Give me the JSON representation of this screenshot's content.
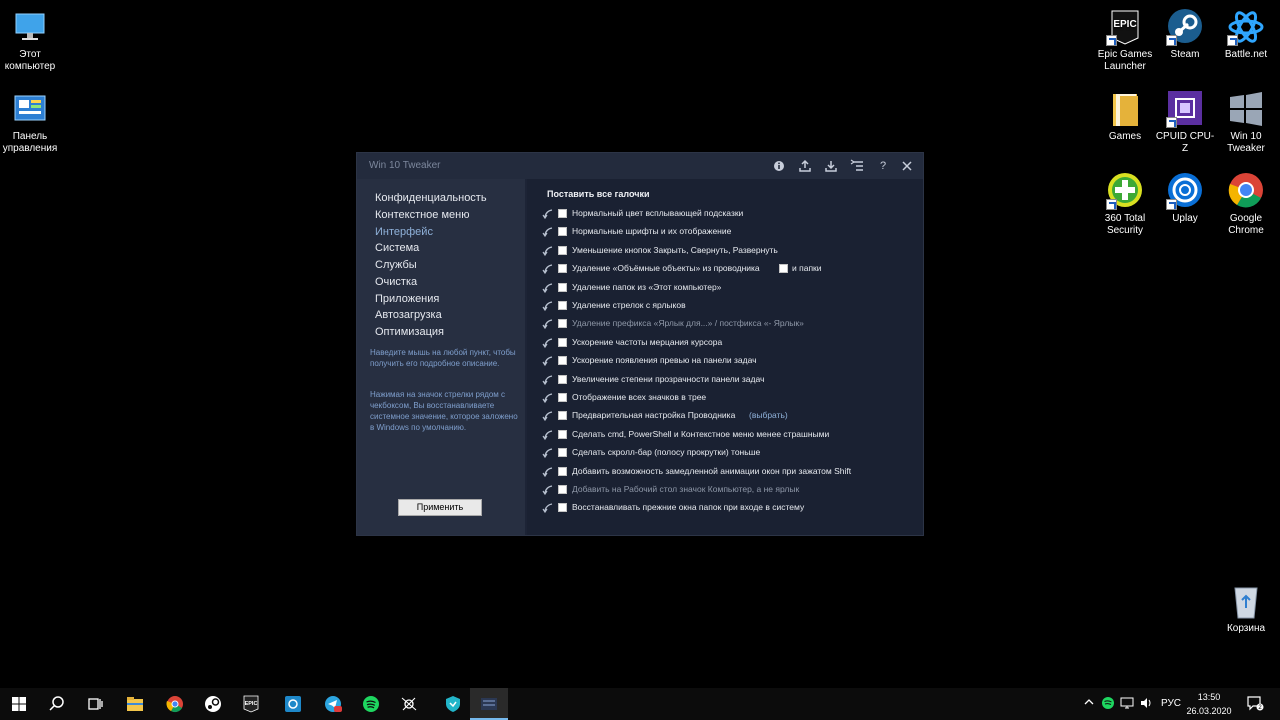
{
  "desktop": {
    "icons": [
      {
        "name": "this-pc",
        "label": "Этот компьютер"
      },
      {
        "name": "control-panel",
        "label": "Панель управления"
      },
      {
        "name": "epic-games",
        "label": "Epic Games Launcher",
        "logo": "EPIC"
      },
      {
        "name": "steam",
        "label": "Steam"
      },
      {
        "name": "battlenet",
        "label": "Battle.net"
      },
      {
        "name": "games",
        "label": "Games"
      },
      {
        "name": "cpuz",
        "label": "CPUID CPU-Z"
      },
      {
        "name": "win10tweaker",
        "label": "Win 10 Tweaker"
      },
      {
        "name": "360",
        "label": "360 Total Security"
      },
      {
        "name": "uplay",
        "label": "Uplay"
      },
      {
        "name": "chrome",
        "label": "Google Chrome"
      },
      {
        "name": "recycle-bin",
        "label": "Корзина"
      }
    ]
  },
  "window": {
    "title": "Win 10 Tweaker",
    "toolbar": {
      "info": "i",
      "export": "⇪",
      "import": "⇩",
      "list": "☰",
      "help": "?",
      "close": "✕"
    },
    "nav": [
      "Конфиденциальность",
      "Контекстное меню",
      "Интерфейс",
      "Система",
      "Службы",
      "Очистка",
      "Приложения",
      "Автозагрузка",
      "Оптимизация"
    ],
    "active_nav": "Интерфейс",
    "hint1": "Наведите мышь на любой пункт, чтобы получить его подробное описание.",
    "hint2": "Нажимая на значок стрелки рядом с чекбоксом, Вы восстанавливаете системное значение, которое заложено в Windows по умолчанию.",
    "apply_label": "Применить",
    "heading": "Поставить все галочки",
    "options": [
      {
        "text": "Нормальный цвет всплывающей подсказки",
        "dim": false
      },
      {
        "text": "Нормальные шрифты и их отображение",
        "dim": false
      },
      {
        "text": "Уменьшение кнопок Закрыть, Свернуть, Развернуть",
        "dim": false
      },
      {
        "text": "Удаление «Объёмные объекты» из проводника",
        "dim": false,
        "extra": "и папки"
      },
      {
        "text": "Удаление папок из «Этот компьютер»",
        "dim": false
      },
      {
        "text": "Удаление стрелок с ярлыков",
        "dim": false
      },
      {
        "text": "Удаление префикса «Ярлык для...» / постфикса «- Ярлык»",
        "dim": true
      },
      {
        "text": "Ускорение частоты мерцания курсора",
        "dim": false
      },
      {
        "text": "Ускорение появления превью на панели задач",
        "dim": false
      },
      {
        "text": "Увеличение степени прозрачности панели задач",
        "dim": false
      },
      {
        "text": "Отображение всех значков в трее",
        "dim": false
      },
      {
        "text": "Предварительная настройка Проводника",
        "dim": false,
        "link": "(выбрать)"
      },
      {
        "text": "Сделать cmd, PowerShell и Контекстное меню менее страшными",
        "dim": false
      },
      {
        "text": "Сделать скролл-бар (полосу прокрутки) тоньше",
        "dim": false
      },
      {
        "text": "Добавить возможность замедленной анимации окон при зажатом Shift",
        "dim": false
      },
      {
        "text": "Добавить на Рабочий стол значок Компьютер, а не ярлык",
        "dim": true
      },
      {
        "text": "Восстанавливать прежние окна папок при входе в систему",
        "dim": false
      }
    ]
  },
  "taskbar": {
    "epic_label": "EPIC",
    "tray": {
      "lang": "РУС",
      "notification_count": "2"
    },
    "clock": {
      "time": "13:50",
      "date": "26.03.2020"
    }
  }
}
